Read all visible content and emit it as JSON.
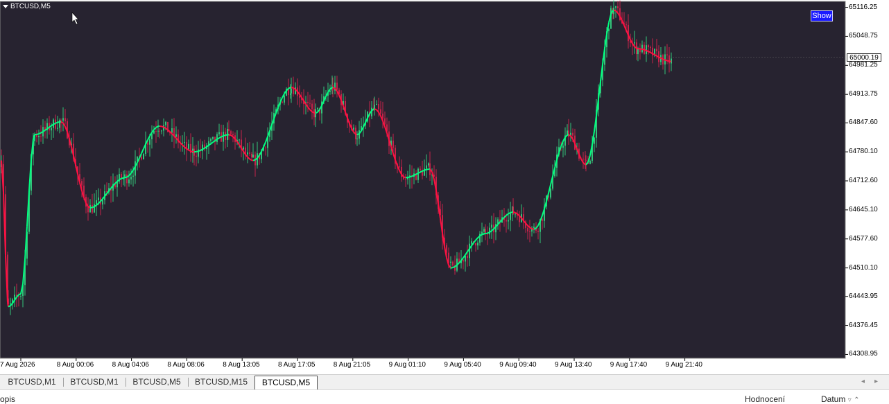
{
  "chart": {
    "symbol": "BTCUSD,M5",
    "show_button": "Show",
    "current_price": "65000.19",
    "background_color": "#272330",
    "bull_color": "#33c47a",
    "bear_color": "#c4234a",
    "ma_up_color": "#00ff80",
    "ma_down_color": "#ff1040",
    "y_ticks": [
      "65116.25",
      "65048.75",
      "64981.25",
      "64913.75",
      "64847.60",
      "64780.10",
      "64712.60",
      "64645.10",
      "64577.60",
      "64510.10",
      "64443.95",
      "64376.45",
      "64308.95"
    ],
    "x_ticks": [
      "7 Aug 2026",
      "8 Aug 00:06",
      "8 Aug 04:06",
      "8 Aug 08:06",
      "8 Aug 13:05",
      "8 Aug 17:05",
      "8 Aug 21:05",
      "9 Aug 01:10",
      "9 Aug 05:40",
      "9 Aug 09:40",
      "9 Aug 13:40",
      "9 Aug 17:40",
      "9 Aug 21:40"
    ]
  },
  "tabs": [
    "BTCUSD,M1",
    "BTCUSD,M1",
    "BTCUSD,M5",
    "BTCUSD,M15",
    "BTCUSD,M5"
  ],
  "active_tab": 4,
  "bottom": {
    "left_label": "opis",
    "col_rating": "Hodnocení",
    "col_date": "Datum"
  },
  "chart_data": {
    "type": "line",
    "title": "BTCUSD,M5",
    "ylim": [
      64300,
      65130
    ],
    "series": [
      {
        "name": "",
        "x": [
          "7 Aug 2026",
          "8 Aug 00:06",
          "8 Aug 04:06",
          "8 Aug 08:06",
          "8 Aug 13:05",
          "8 Aug 17:05",
          "8 Aug 21:05",
          "9 Aug 01:10",
          "9 Aug 05:40",
          "9 Aug 09:40",
          "9 Aug 13:40",
          "9 Aug 17:40",
          "9 Aug 21:40"
        ],
        "values": [
          64450,
          64830,
          64720,
          64840,
          64790,
          64910,
          64810,
          64700,
          64560,
          64650,
          64760,
          65100,
          64990
        ]
      }
    ]
  }
}
